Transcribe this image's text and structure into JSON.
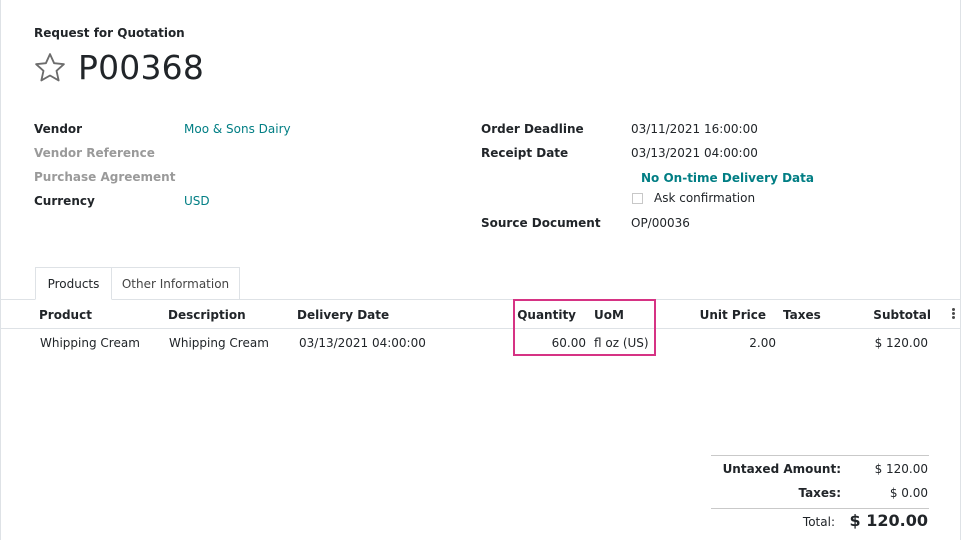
{
  "header": {
    "doc_type": "Request for Quotation",
    "order_name": "P00368",
    "star_icon": "star-outline-icon"
  },
  "fields_left": {
    "vendor_label": "Vendor",
    "vendor_value": "Moo & Sons Dairy",
    "vendor_reference_label": "Vendor Reference",
    "purchase_agreement_label": "Purchase Agreement",
    "currency_label": "Currency",
    "currency_value": "USD"
  },
  "fields_right": {
    "order_deadline_label": "Order Deadline",
    "order_deadline_value": "03/11/2021 16:00:00",
    "receipt_date_label": "Receipt Date",
    "receipt_date_value": "03/13/2021 04:00:00",
    "delivery_data_link": "No On-time Delivery Data",
    "ask_confirmation_label": "Ask confirmation",
    "ask_confirmation_checked": false,
    "source_document_label": "Source Document",
    "source_document_value": "OP/00036"
  },
  "tabs": [
    {
      "label": "Products",
      "active": true
    },
    {
      "label": "Other Information",
      "active": false
    }
  ],
  "table": {
    "columns": {
      "product": "Product",
      "description": "Description",
      "delivery_date": "Delivery Date",
      "quantity": "Quantity",
      "uom": "UoM",
      "unit_price": "Unit Price",
      "taxes": "Taxes",
      "subtotal": "Subtotal"
    },
    "rows": [
      {
        "product": "Whipping Cream",
        "description": "Whipping Cream",
        "delivery_date": "03/13/2021 04:00:00",
        "quantity": "60.00",
        "uom": "fl oz (US)",
        "unit_price": "2.00",
        "taxes": "",
        "subtotal": "$ 120.00"
      }
    ],
    "highlight_color": "#d63384"
  },
  "totals": {
    "untaxed_label": "Untaxed Amount:",
    "untaxed_value": "$ 120.00",
    "taxes_label": "Taxes:",
    "taxes_value": "$ 0.00",
    "total_label": "Total:",
    "total_value": "$ 120.00"
  },
  "colors": {
    "link": "#017e84",
    "muted_label": "#9a9a9a",
    "highlight": "#d63384"
  }
}
